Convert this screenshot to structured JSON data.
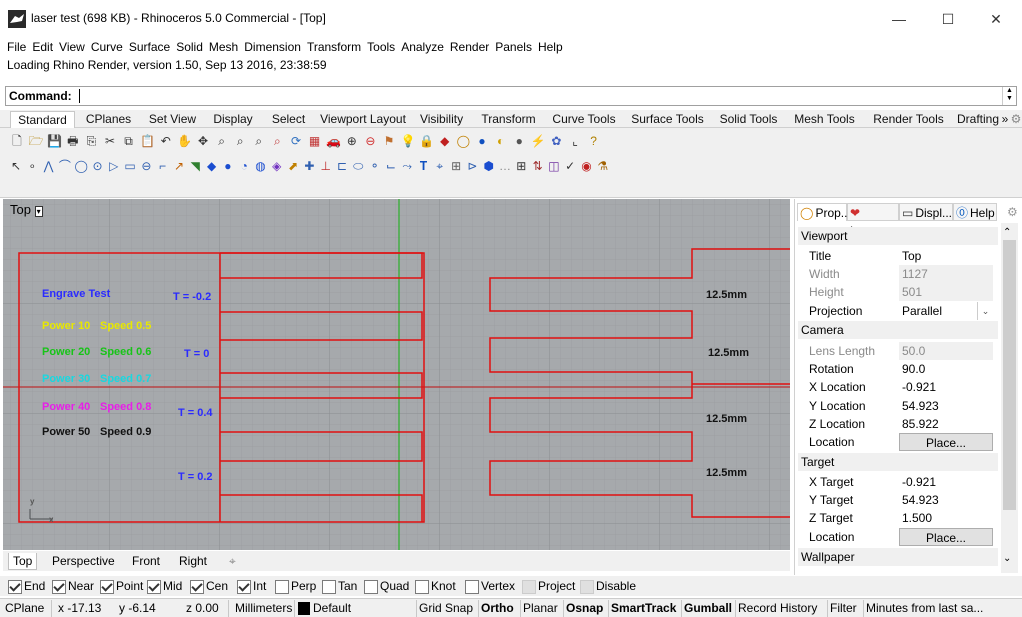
{
  "window": {
    "title": "laser test (698 KB) - Rhinoceros 5.0 Commercial - [Top]",
    "minimize": "—",
    "maximize": "☐",
    "close": "✕"
  },
  "menu": [
    "File",
    "Edit",
    "View",
    "Curve",
    "Surface",
    "Solid",
    "Mesh",
    "Dimension",
    "Transform",
    "Tools",
    "Analyze",
    "Render",
    "Panels",
    "Help"
  ],
  "status_message": "Loading Rhino Render, version 1.50, Sep 13 2016, 23:38:59",
  "command": {
    "label": "Command:",
    "value": ""
  },
  "toolbar_tabs": [
    "Standard",
    "CPlanes",
    "Set View",
    "Display",
    "Select",
    "Viewport Layout",
    "Visibility",
    "Transform",
    "Curve Tools",
    "Surface Tools",
    "Solid Tools",
    "Mesh Tools",
    "Render Tools",
    "Drafting"
  ],
  "toolbar_more": "»",
  "viewport": {
    "label": "Top",
    "labels": {
      "engrave": "Engrave Test",
      "p10": "Power 10",
      "s05": "Speed 0.5",
      "p20": "Power 20",
      "s06": "Speed 0.6",
      "p30": "Power 30",
      "s07": "Speed 0.7",
      "p40": "Power 40",
      "s08": "Speed 0.8",
      "p50": "Power 50",
      "s09": "Speed 0.9",
      "t1": "T = -0.2",
      "t2": "T = 0",
      "t3": "T = 0.4",
      "t4": "T = 0.2",
      "m1": "12.5mm",
      "m2": "12.5mm",
      "m3": "12.5mm",
      "m4": "12.5mm",
      "axis_y": "y",
      "axis_x": "x"
    },
    "colors": {
      "engrave": "#2b2bff",
      "p10": "#e8e800",
      "p20": "#17c417",
      "p30": "#18d8e0",
      "p40": "#e81ee8",
      "p50": "#111111",
      "t": "#2b2bff",
      "m": "#111111",
      "curve": "#e01010",
      "grid_y": "#2bb02b"
    }
  },
  "view_tabs": [
    "Top",
    "Perspective",
    "Front",
    "Right"
  ],
  "view_tab_add": "⌖",
  "osnaps": [
    {
      "label": "End",
      "checked": true
    },
    {
      "label": "Near",
      "checked": true
    },
    {
      "label": "Point",
      "checked": true
    },
    {
      "label": "Mid",
      "checked": true
    },
    {
      "label": "Cen",
      "checked": true
    },
    {
      "label": "Int",
      "checked": true
    },
    {
      "label": "Perp",
      "checked": false
    },
    {
      "label": "Tan",
      "checked": false
    },
    {
      "label": "Quad",
      "checked": false
    },
    {
      "label": "Knot",
      "checked": false
    },
    {
      "label": "Vertex",
      "checked": false
    },
    {
      "label": "Project",
      "checked": false,
      "disabled": true
    },
    {
      "label": "Disable",
      "checked": false,
      "disabled": true
    }
  ],
  "statusbar": {
    "cplane": "CPlane",
    "x": "x -17.13",
    "y": "y -6.14",
    "z": "z 0.00",
    "units": "Millimeters",
    "layer": "Default",
    "toggles": [
      {
        "label": "Grid Snap",
        "bold": false
      },
      {
        "label": "Ortho",
        "bold": true
      },
      {
        "label": "Planar",
        "bold": false
      },
      {
        "label": "Osnap",
        "bold": true
      },
      {
        "label": "SmartTrack",
        "bold": true
      },
      {
        "label": "Gumball",
        "bold": true
      },
      {
        "label": "Record History",
        "bold": false
      },
      {
        "label": "Filter",
        "bold": false
      },
      {
        "label": "Minutes from last sa...",
        "bold": false
      }
    ]
  },
  "panel": {
    "tabs": [
      "Prop...",
      "Laye...",
      "Displ...",
      "Help"
    ],
    "sections": {
      "viewport": "Viewport",
      "camera": "Camera",
      "target": "Target",
      "wallpaper": "Wallpaper"
    },
    "viewport_rows": [
      {
        "label": "Title",
        "value": "Top",
        "grey": false
      },
      {
        "label": "Width",
        "value": "1127",
        "grey": true
      },
      {
        "label": "Height",
        "value": "501",
        "grey": true
      },
      {
        "label": "Projection",
        "value": "Parallel",
        "grey": false
      }
    ],
    "camera_rows": [
      {
        "label": "Lens Length",
        "value": "50.0",
        "grey": true
      },
      {
        "label": "Rotation",
        "value": "90.0",
        "grey": false
      },
      {
        "label": "X Location",
        "value": "-0.921",
        "grey": false
      },
      {
        "label": "Y Location",
        "value": "54.923",
        "grey": false
      },
      {
        "label": "Z Location",
        "value": "85.922",
        "grey": false
      },
      {
        "label": "Location",
        "value": "Place...",
        "grey": false,
        "button": true
      }
    ],
    "target_rows": [
      {
        "label": "X Target",
        "value": "-0.921",
        "grey": false
      },
      {
        "label": "Y Target",
        "value": "54.923",
        "grey": false
      },
      {
        "label": "Z Target",
        "value": "1.500",
        "grey": false
      },
      {
        "label": "Location",
        "value": "Place...",
        "grey": false,
        "button": true
      }
    ]
  }
}
